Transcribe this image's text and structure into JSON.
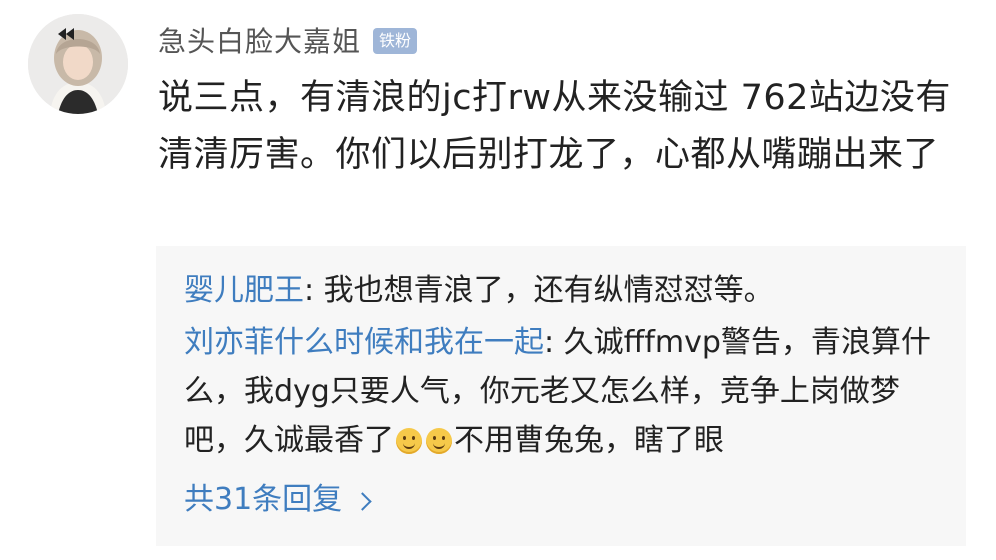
{
  "comment": {
    "username": "急头白脸大嘉姐",
    "badge": "铁粉",
    "text": "说三点，有清浪的jc打rw从来没输过 762站边没有清清厉害。你们以后别打龙了，心都从嘴蹦出来了"
  },
  "replies": [
    {
      "author": "婴儿肥王",
      "separator": ": ",
      "text": "我也想青浪了，还有纵情怼怼等。"
    },
    {
      "author": "刘亦菲什么时候和我在一起",
      "separator": ": ",
      "text_before_emoji": "久诚fffmvp警告，青浪算什么，我dyg只要人气，你元老又怎么样，竞争上岗做梦吧，久诚最香了",
      "text_after_emoji": "不用曹兔兔，瞎了眼",
      "emojis": [
        "smile-emoji",
        "smile-emoji"
      ]
    }
  ],
  "more_replies_label": "共31条回复",
  "colors": {
    "author_blue": "#3f7dbf",
    "badge_bg": "#9fb6d8",
    "reply_box_bg": "#f7f7f7",
    "text": "#222222",
    "username": "#555555"
  },
  "icons": {
    "avatar": "user-avatar",
    "more": "chevron-right-icon"
  }
}
